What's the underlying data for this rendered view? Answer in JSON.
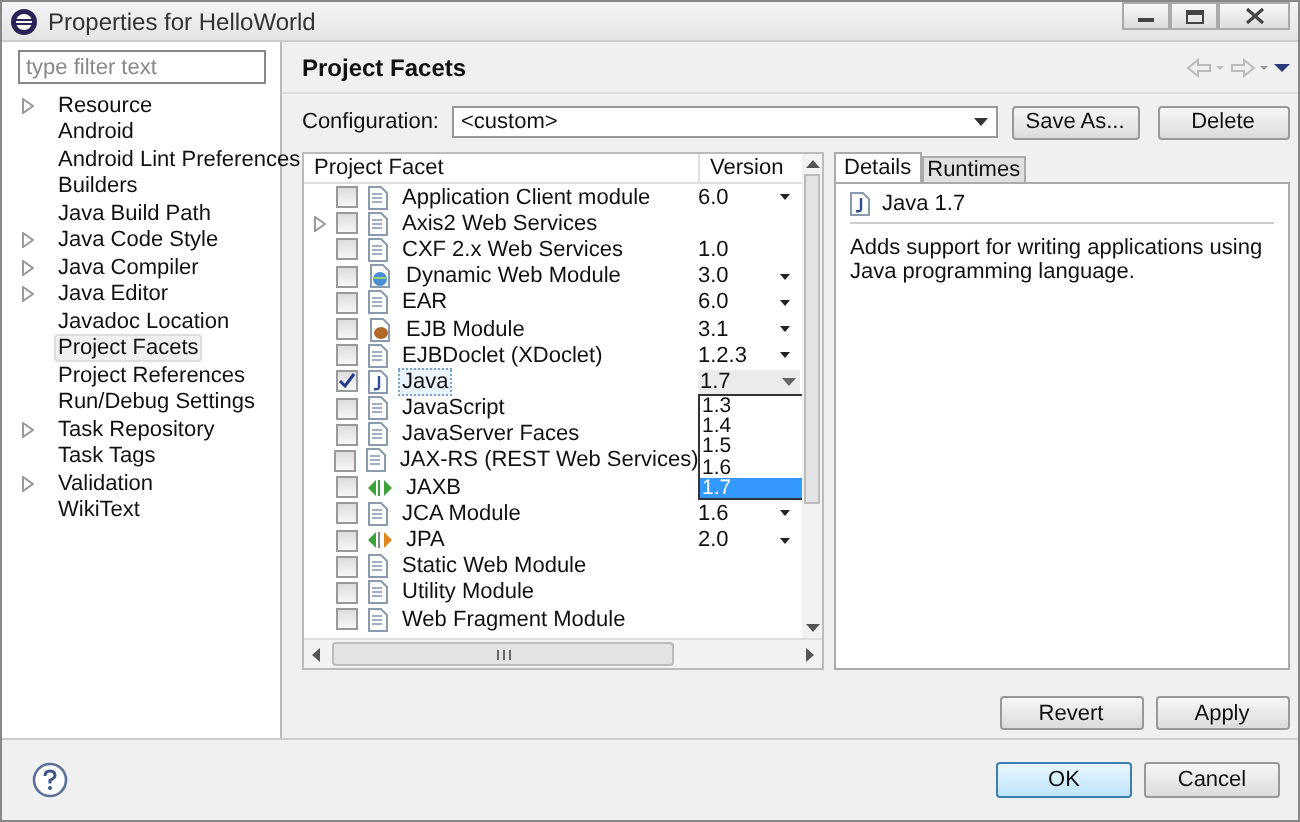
{
  "window": {
    "title": "Properties for HelloWorld"
  },
  "filter": {
    "placeholder": "type filter text"
  },
  "sidebar": {
    "items": [
      {
        "label": "Resource",
        "expandable": true,
        "selected": false
      },
      {
        "label": "Android",
        "expandable": false,
        "selected": false
      },
      {
        "label": "Android Lint Preferences",
        "expandable": false,
        "selected": false
      },
      {
        "label": "Builders",
        "expandable": false,
        "selected": false
      },
      {
        "label": "Java Build Path",
        "expandable": false,
        "selected": false
      },
      {
        "label": "Java Code Style",
        "expandable": true,
        "selected": false
      },
      {
        "label": "Java Compiler",
        "expandable": true,
        "selected": false
      },
      {
        "label": "Java Editor",
        "expandable": true,
        "selected": false
      },
      {
        "label": "Javadoc Location",
        "expandable": false,
        "selected": false
      },
      {
        "label": "Project Facets",
        "expandable": false,
        "selected": true
      },
      {
        "label": "Project References",
        "expandable": false,
        "selected": false
      },
      {
        "label": "Run/Debug Settings",
        "expandable": false,
        "selected": false
      },
      {
        "label": "Task Repository",
        "expandable": true,
        "selected": false
      },
      {
        "label": "Task Tags",
        "expandable": false,
        "selected": false
      },
      {
        "label": "Validation",
        "expandable": true,
        "selected": false
      },
      {
        "label": "WikiText",
        "expandable": false,
        "selected": false
      }
    ]
  },
  "page": {
    "title": "Project Facets"
  },
  "configuration": {
    "label": "Configuration:",
    "value": "<custom>"
  },
  "config_buttons": [
    "Save As...",
    "Delete"
  ],
  "facet_table": {
    "columns": [
      "Project Facet",
      "Version"
    ],
    "rows": [
      {
        "name": "Application Client module",
        "kind": "doc",
        "checked": false,
        "expandable": false,
        "selected": false,
        "version": "6.0",
        "has_dropdown": true
      },
      {
        "name": "Axis2 Web Services",
        "kind": "doc",
        "checked": false,
        "expandable": true,
        "selected": false
      },
      {
        "name": "CXF 2.x Web Services",
        "kind": "doc",
        "checked": false,
        "expandable": false,
        "selected": false,
        "version": "1.0",
        "has_dropdown": false
      },
      {
        "name": "Dynamic Web Module",
        "kind": "web",
        "checked": false,
        "expandable": false,
        "selected": false,
        "version": "3.0",
        "has_dropdown": true
      },
      {
        "name": "EAR",
        "kind": "doc",
        "checked": false,
        "expandable": false,
        "selected": false,
        "version": "6.0",
        "has_dropdown": true
      },
      {
        "name": "EJB Module",
        "kind": "ejb",
        "checked": false,
        "expandable": false,
        "selected": false,
        "version": "3.1",
        "has_dropdown": true
      },
      {
        "name": "EJBDoclet (XDoclet)",
        "kind": "doc",
        "checked": false,
        "expandable": false,
        "selected": false,
        "version": "1.2.3",
        "has_dropdown": true
      },
      {
        "name": "Java",
        "kind": "java",
        "checked": true,
        "expandable": false,
        "selected": true,
        "version": "1.7",
        "has_dropdown": true
      },
      {
        "name": "JavaScript",
        "kind": "doc",
        "checked": false,
        "expandable": false,
        "selected": false
      },
      {
        "name": "JavaServer Faces",
        "kind": "doc",
        "checked": false,
        "expandable": false,
        "selected": false
      },
      {
        "name": "JAX-RS (REST Web Services)",
        "kind": "doc",
        "checked": false,
        "expandable": false,
        "selected": false
      },
      {
        "name": "JAXB",
        "kind": "jaxb",
        "checked": false,
        "expandable": false,
        "selected": false
      },
      {
        "name": "JCA Module",
        "kind": "doc",
        "checked": false,
        "expandable": false,
        "selected": false,
        "version": "1.6",
        "has_dropdown": true
      },
      {
        "name": "JPA",
        "kind": "jpa",
        "checked": false,
        "expandable": false,
        "selected": false,
        "version": "2.0",
        "has_dropdown": true
      },
      {
        "name": "Static Web Module",
        "kind": "doc",
        "checked": false,
        "expandable": false,
        "selected": false
      },
      {
        "name": "Utility Module",
        "kind": "doc",
        "checked": false,
        "expandable": false,
        "selected": false
      },
      {
        "name": "Web Fragment Module",
        "kind": "doc",
        "checked": false,
        "expandable": false,
        "selected": false
      }
    ]
  },
  "version_dropdown": {
    "options": [
      {
        "label": "1.3",
        "selected": false
      },
      {
        "label": "1.4",
        "selected": false
      },
      {
        "label": "1.5",
        "selected": false
      },
      {
        "label": "1.6",
        "selected": false
      },
      {
        "label": "1.7",
        "selected": true
      }
    ]
  },
  "details": {
    "tabs": [
      {
        "label": "Details",
        "selected": true
      },
      {
        "label": "Runtimes",
        "selected": false
      }
    ],
    "heading": "Java 1.7",
    "description": "Adds support for writing applications using Java programming language."
  },
  "page_buttons": [
    "Revert",
    "Apply"
  ],
  "dialog_buttons": [
    {
      "label": "OK",
      "default": true
    },
    {
      "label": "Cancel",
      "default": false
    }
  ]
}
